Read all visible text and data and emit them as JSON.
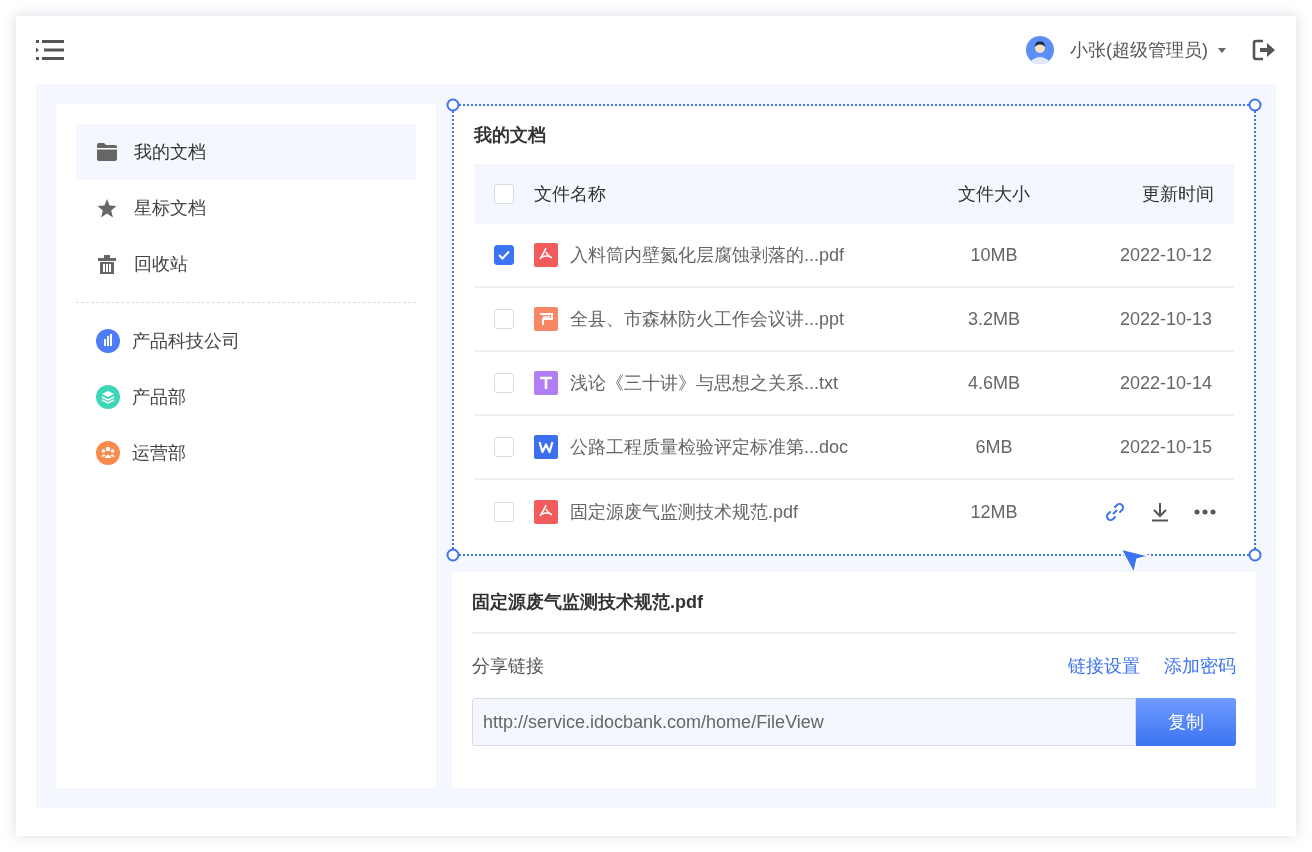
{
  "header": {
    "user_name": "小张(超级管理员)"
  },
  "sidebar": {
    "items": [
      {
        "label": "我的文档",
        "kind": "folder",
        "selected": true
      },
      {
        "label": "星标文档",
        "kind": "star",
        "selected": false
      },
      {
        "label": "回收站",
        "kind": "trash",
        "selected": false
      }
    ],
    "groups": [
      {
        "label": "产品科技公司",
        "kind": "company",
        "color": "#4f7cf7"
      },
      {
        "label": "产品部",
        "kind": "product",
        "color": "#3dd6b8"
      },
      {
        "label": "运营部",
        "kind": "operations",
        "color": "#f98a4b"
      }
    ]
  },
  "file_panel": {
    "title": "我的文档",
    "table": {
      "columns": [
        "文件名称",
        "文件大小",
        "更新时间"
      ],
      "all_checked": false,
      "rows": [
        {
          "name": "入料筒内壁氮化层腐蚀剥落的...pdf",
          "kind": "pdf",
          "size": "10MB",
          "date": "2022-10-12",
          "checked": true,
          "hovered": false
        },
        {
          "name": "全县、市森林防火工作会议讲...ppt",
          "kind": "ppt",
          "size": "3.2MB",
          "date": "2022-10-13",
          "checked": false,
          "hovered": false
        },
        {
          "name": "浅论《三十讲》与思想之关系...txt",
          "kind": "txt",
          "size": "4.6MB",
          "date": "2022-10-14",
          "checked": false,
          "hovered": false
        },
        {
          "name": "公路工程质量检验评定标准第...doc",
          "kind": "doc",
          "size": "6MB",
          "date": "2022-10-15",
          "checked": false,
          "hovered": false
        },
        {
          "name": "固定源废气监测技术规范.pdf",
          "kind": "pdf",
          "size": "12MB",
          "checked": false,
          "hovered": true
        }
      ]
    }
  },
  "share_panel": {
    "file_name": "固定源废气监测技术规范.pdf",
    "label": "分享链接",
    "links": [
      "链接设置",
      "添加密码"
    ],
    "url": "http://service.idocbank.com/home/FileView",
    "copy_button": "复制"
  }
}
